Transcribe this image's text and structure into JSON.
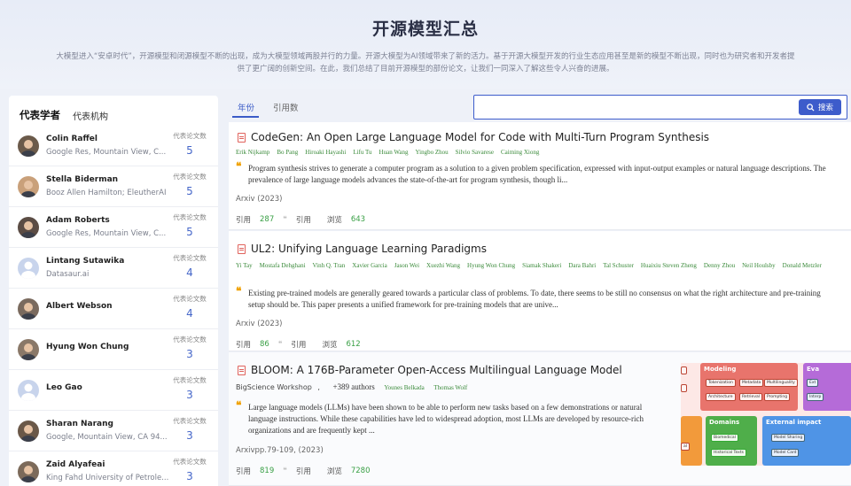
{
  "page": {
    "title": "开源模型汇总",
    "intro": "大模型进入“安卓时代”，开源模型和闭源模型不断的出现，成为大模型领域两股并行的力量。开源大模型为AI领域带来了新的活力。基于开源大模型开发的行业生态应用甚至是新的模型不断出现，同时也为研究者和开发者提供了更广阔的创新空间。在此，我们总结了目前开源模型的部份论文，让我们一同深入了解这些令人兴奋的进展。"
  },
  "left_tabs": [
    "代表学者",
    "代表机构"
  ],
  "scholars": [
    {
      "name": "Colin Raffel",
      "affiliation": "Google Res, Mountain View, C...",
      "papers_label": "代表论文数",
      "papers": "5"
    },
    {
      "name": "Stella Biderman",
      "affiliation": "Booz Allen Hamilton; EleutherAI",
      "papers_label": "代表论文数",
      "papers": "5"
    },
    {
      "name": "Adam Roberts",
      "affiliation": "Google Res, Mountain View, C...",
      "papers_label": "代表论文数",
      "papers": "5"
    },
    {
      "name": "Lintang Sutawika",
      "affiliation": "Datasaur.ai",
      "papers_label": "代表论文数",
      "papers": "4"
    },
    {
      "name": "Albert Webson",
      "affiliation": "",
      "papers_label": "代表论文数",
      "papers": "4"
    },
    {
      "name": "Hyung Won Chung",
      "affiliation": "",
      "papers_label": "代表论文数",
      "papers": "3"
    },
    {
      "name": "Leo Gao",
      "affiliation": "",
      "papers_label": "代表论文数",
      "papers": "3"
    },
    {
      "name": "Sharan Narang",
      "affiliation": "Google, Mountain View, CA 94...",
      "papers_label": "代表论文数",
      "papers": "3"
    },
    {
      "name": "Zaid Alyafeai",
      "affiliation": "King Fahd University of Petrole...",
      "papers_label": "代表论文数",
      "papers": "3"
    }
  ],
  "right_tabs": [
    "年份",
    "引用数"
  ],
  "search": {
    "placeholder": "",
    "button": "搜索"
  },
  "papers": [
    {
      "title": "CodeGen: An Open Large Language Model for Code with Multi-Turn Program Synthesis",
      "authors": [
        "Erik Nijkamp",
        "Bo Pang",
        "Hiroaki Hayashi",
        "Lifu Tu",
        "Huan Wang",
        "Yingbo Zhou",
        "Silvio Savarese",
        "Caiming Xiong"
      ],
      "abstract": "Program synthesis strives to generate a computer program as a solution to a given problem specification, expressed with input-output examples or natural language descriptions. The prevalence of large language models advances the state-of-the-art for program synthesis, though li...",
      "venue": "Arxiv (2023)",
      "cite_label": "引用",
      "cite_count": "287",
      "quote_label": "引用",
      "view_label": "浏览",
      "view_count": "643"
    },
    {
      "title": "UL2: Unifying Language Learning Paradigms",
      "authors": [
        "Yi Tay",
        "Mostafa Dehghani",
        "Vinh Q. Tran",
        "Xavier Garcia",
        "Jason Wei",
        "Xuezhi Wang",
        "Hyung Won Chung",
        "Siamak Shakeri",
        "Dara Bahri",
        "Tal Schuster",
        "Huaixiu Steven Zheng",
        "Denny Zhou",
        "Neil Houlsby",
        "Donald Metzler"
      ],
      "abstract": "Existing pre-trained models are generally geared towards a particular class of problems. To date, there seems to be still no consensus on what the right architecture and pre-training setup should be. This paper presents a unified framework for pre-training models that are unive...",
      "venue": "Arxiv (2023)",
      "cite_label": "引用",
      "cite_count": "86",
      "quote_label": "引用",
      "view_label": "浏览",
      "view_count": "612"
    },
    {
      "title": "BLOOM: A 176B-Parameter Open-Access Multilingual Language Model",
      "org": "BigScience Workshop",
      "org_sep": ",",
      "more_authors": "+389 authors",
      "authors": [
        "Younes Belkada",
        "Thomas Wolf"
      ],
      "abstract": "Large language models (LLMs) have been shown to be able to perform new tasks based on a few demonstrations or natural language instructions. While these capabilities have led to widespread adoption, most LLMs are developed by resource-rich organizations and are frequently kept ...",
      "venue": "Arxivpp.79-109, (2023)",
      "cite_label": "引用",
      "cite_count": "819",
      "quote_label": "引用",
      "view_label": "浏览",
      "view_count": "7280",
      "thumb": {
        "modeling": "Modeling",
        "modeling_items": [
          "Tokenization",
          "Metadata",
          "Multilinguality",
          "Architecture",
          "Retrieval",
          "Prompting"
        ],
        "eval": "Eva",
        "eval_items": [
          "Ext",
          "Interp"
        ],
        "domains": "Domains",
        "domains_items": [
          "Biomedical",
          "Historical Texts"
        ],
        "external": "External impact",
        "external_items": [
          "Model Sharing",
          "Model Card"
        ],
        "orange_items": [
          "al"
        ]
      }
    }
  ],
  "colors": {
    "accent": "#3d5ccb",
    "count_blue": "#4566c9",
    "green": "#3aa046",
    "quote": "#f0a100"
  }
}
